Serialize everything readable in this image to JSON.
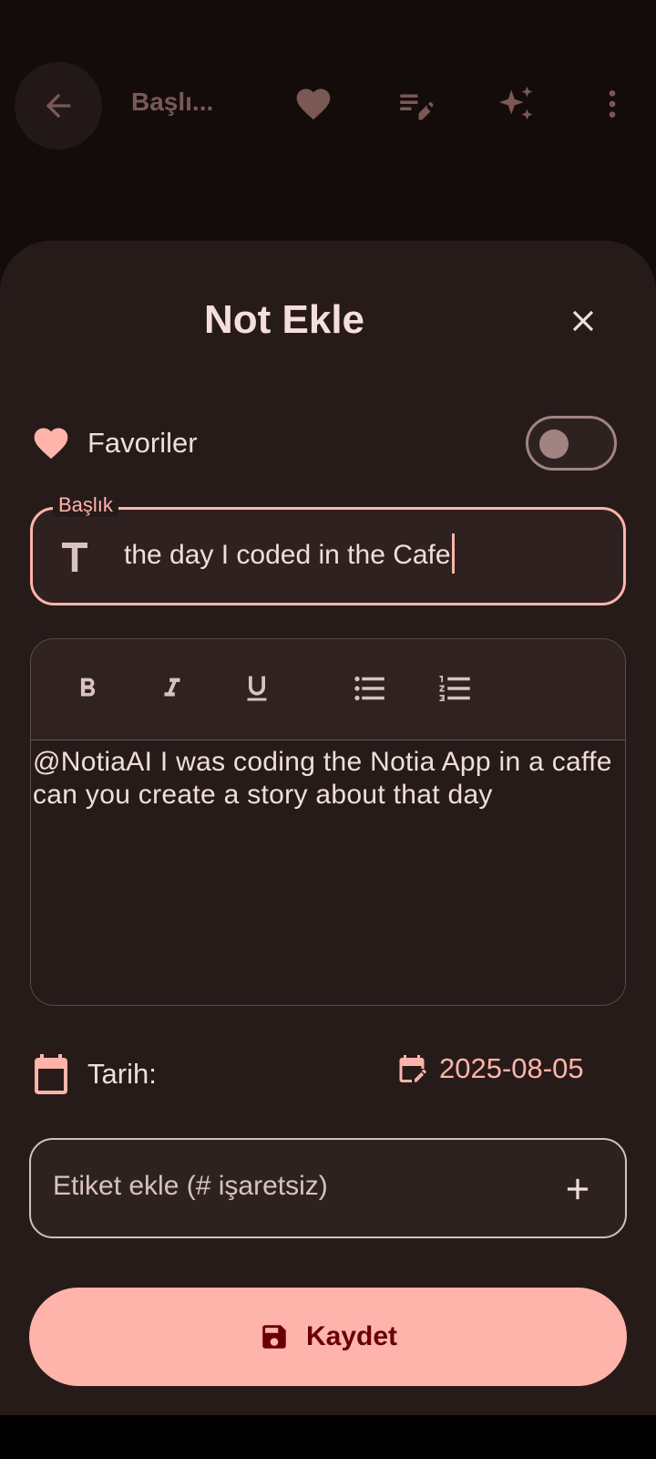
{
  "topbar": {
    "title": "Başlı...",
    "icons": [
      "back-arrow-icon",
      "heart-icon",
      "edit-list-icon",
      "sparkles-icon",
      "more-vert-icon"
    ]
  },
  "sheet": {
    "title": "Not Ekle",
    "favorites": {
      "label": "Favoriler",
      "enabled": false
    },
    "title_field": {
      "label": "Başlık",
      "value": "the day I coded in the Cafe"
    },
    "editor": {
      "toolbar": [
        "bold",
        "italic",
        "underline",
        "bullet-list",
        "numbered-list"
      ],
      "content": "@NotiaAI I was coding the Notia App in a caffe can you create a story about that day"
    },
    "date": {
      "label": "Tarih:",
      "value": "2025-08-05"
    },
    "tag": {
      "placeholder": "Etiket ekle (# işaretsiz)"
    },
    "save": {
      "label": "Kaydet"
    }
  },
  "colors": {
    "background": "#130c0b",
    "surface": "#271b1a",
    "accent": "#ffb4ab",
    "on_accent": "#690005",
    "text": "#f0dedb"
  }
}
